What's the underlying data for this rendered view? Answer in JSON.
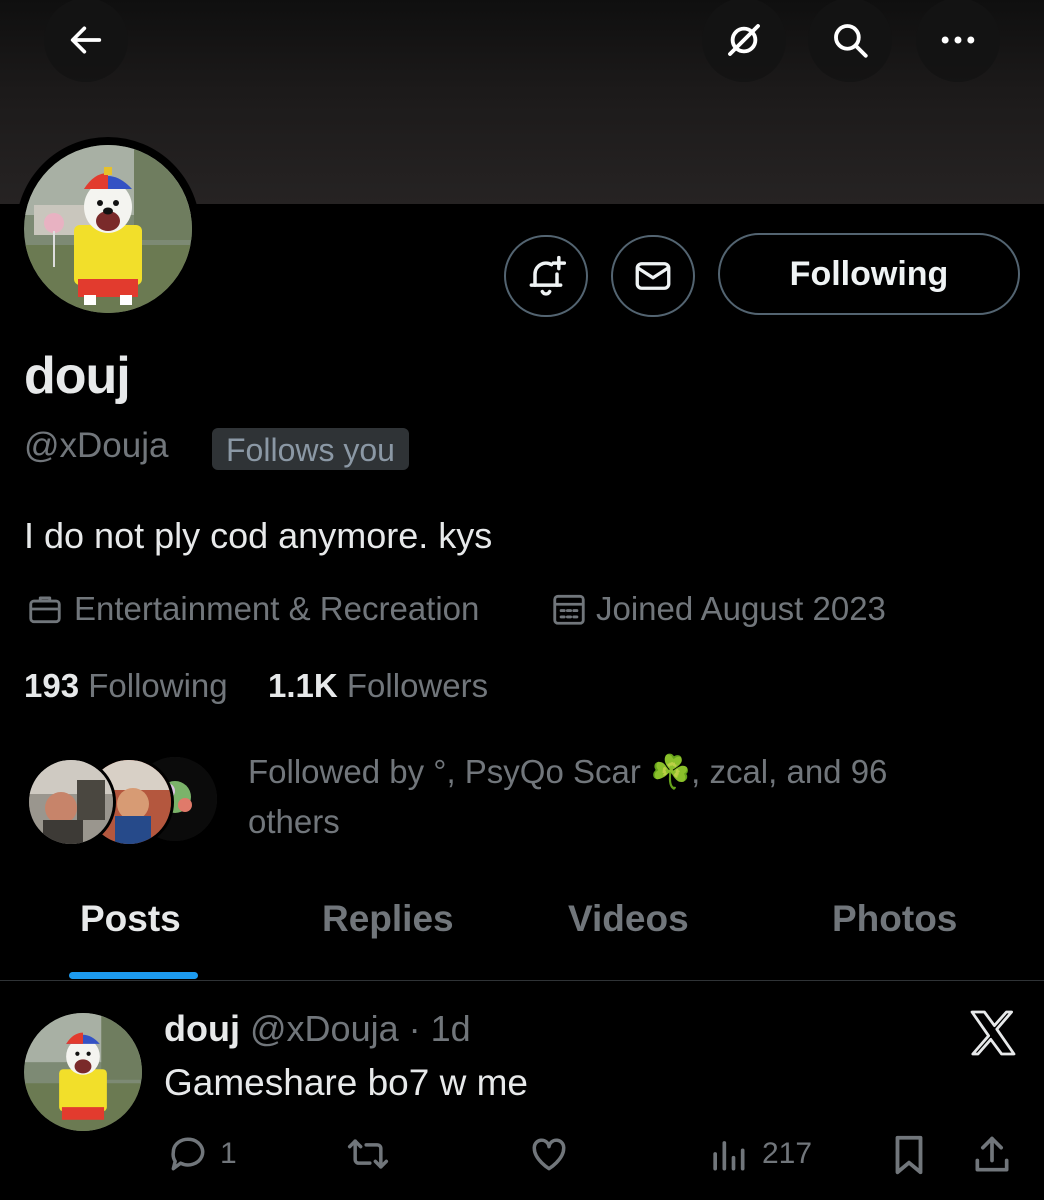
{
  "profile": {
    "display_name": "douj",
    "handle": "@xDouja",
    "follows_you": "Follows you",
    "bio": "I do not ply cod anymore. kys",
    "category": "Entertainment & Recreation",
    "joined": "Joined August 2023",
    "following_count": "193",
    "following_label": "Following",
    "followers_count": "1.1K",
    "followers_label": "Followers",
    "followed_by_pre": "Followed by °, PsyQo Scar ",
    "followed_by_emoji": "☘️",
    "followed_by_post": ", zcal, and 96 others"
  },
  "actions": {
    "following_button": "Following"
  },
  "tabs": [
    {
      "label": "Posts",
      "active": true
    },
    {
      "label": "Replies",
      "active": false
    },
    {
      "label": "Videos",
      "active": false
    },
    {
      "label": "Photos",
      "active": false
    }
  ],
  "post": {
    "name": "douj",
    "handle_time": "@xDouja · 1d",
    "text": "Gameshare bo7 w me",
    "replies": "1",
    "views": "217"
  },
  "colors": {
    "accent": "#1d9bf0",
    "background": "#000000",
    "muted": "#71767b"
  },
  "icons": [
    "back-arrow-icon",
    "grok-icon",
    "search-icon",
    "more-icon",
    "bell-plus-icon",
    "mail-icon",
    "briefcase-icon",
    "calendar-icon",
    "x-logo-icon",
    "reply-icon",
    "repost-icon",
    "like-icon",
    "views-icon",
    "bookmark-icon",
    "share-icon"
  ]
}
